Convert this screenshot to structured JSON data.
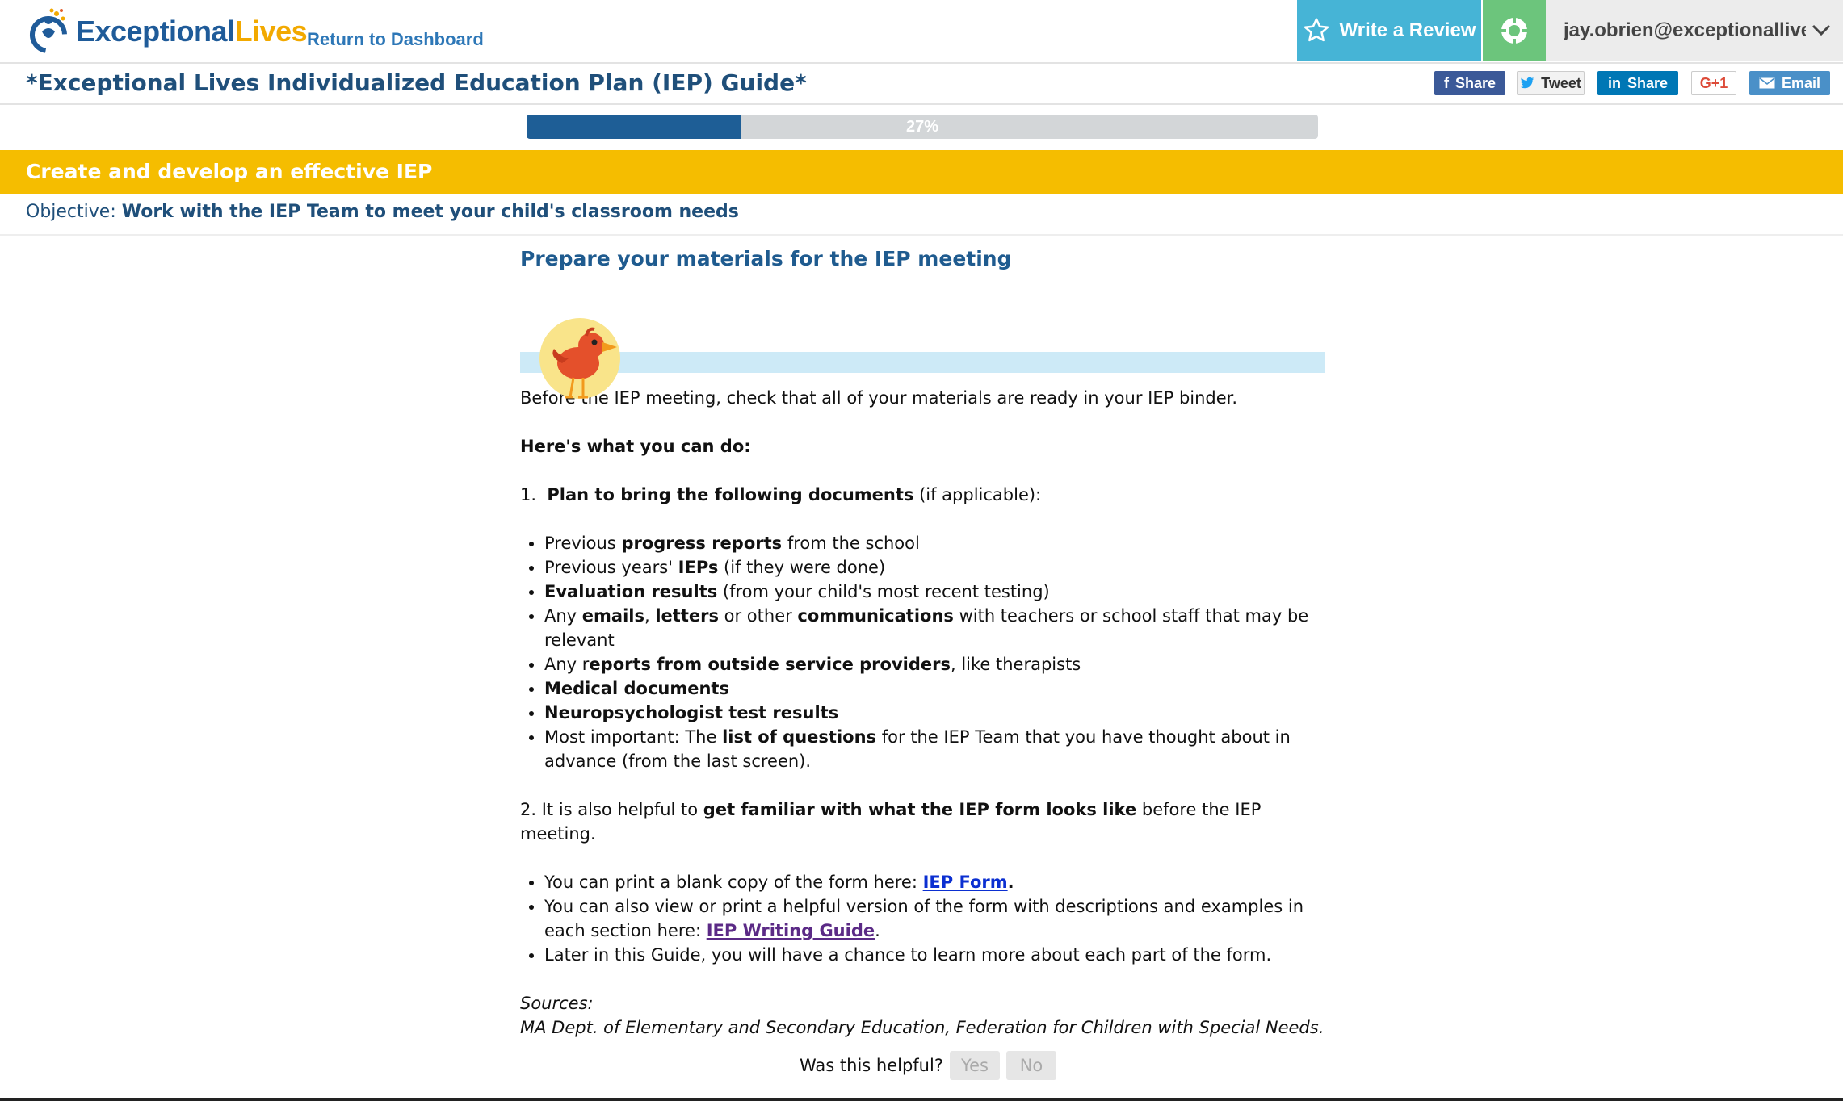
{
  "header": {
    "logo_part1": "Exceptional",
    "logo_part2": "Lives",
    "return_link": "Return to Dashboard",
    "write_review": "Write a Review",
    "user_email": "jay.obrien@exceptionallive"
  },
  "title_row": {
    "title": "*Exceptional Lives Individualized Education Plan (IEP) Guide*",
    "share_facebook": "Share",
    "share_twitter": "Tweet",
    "share_linkedin": "Share",
    "share_google": "G+1",
    "share_email": "Email"
  },
  "progress": {
    "value_percent": 27,
    "label": "27%"
  },
  "section": {
    "title": "Create and develop an effective IEP",
    "objective_label": "Objective:",
    "objective_value": "Work with the IEP Team to meet your child's classroom needs"
  },
  "content": {
    "heading": "Prepare your materials for the IEP meeting",
    "intro": "Before the IEP meeting, check that all of your materials are ready in your IEP binder.",
    "what_to_do": "Here's what you can do:",
    "step1_num": "1.",
    "step1_bold": "Plan to bring the following documents",
    "step1_rest": " (if applicable):",
    "docs": {
      "d1a": "Previous ",
      "d1b": "progress reports",
      "d1c": " from the school",
      "d2a": "Previous years' ",
      "d2b": "IEPs",
      "d2c": " (if they were done)",
      "d3a": "Evaluation results",
      "d3b": " (from your child's most recent testing)",
      "d4a": "Any ",
      "d4b": "emails",
      "d4c": ", ",
      "d4d": "letters",
      "d4e": " or other ",
      "d4f": "communications",
      "d4g": " with teachers or school staff that may be relevant",
      "d5a": "Any r",
      "d5b": "eports from outside service providers",
      "d5c": ", like therapists",
      "d6": "Medical documents",
      "d7": "Neuropsychologist test results",
      "d8a": "Most important: The ",
      "d8b": "list of questions",
      "d8c": " for the IEP Team that you have thought about in advance (from the last screen)."
    },
    "step2_a": "2. It is also helpful to ",
    "step2_b": "get familiar with what the IEP form looks like",
    "step2_c": " before the IEP meeting.",
    "form_items": {
      "f1a": "You can print a blank copy of the form here: ",
      "f1_link": "IEP Form",
      "f1b": ".",
      "f2a": "You can also view or print a helpful version of the form with descriptions and examples in each section here: ",
      "f2_link": "IEP Writing Guide",
      "f2b": ".",
      "f3": "Later in this Guide, you will have a chance to learn more about each part of the form."
    },
    "sources_label": "Sources:",
    "sources_text": "MA Dept. of Elementary and Secondary Education, Federation for Children with Special Needs."
  },
  "feedback": {
    "question": "Was this helpful?",
    "yes": "Yes",
    "no": "No"
  },
  "colors": {
    "brand_blue": "#1f5b99",
    "brand_orange": "#f2a900",
    "section_yellow": "#f5bd00",
    "progress_fill": "#1e5e96",
    "review_button": "#46b4d6",
    "target_button": "#6cc57c"
  }
}
